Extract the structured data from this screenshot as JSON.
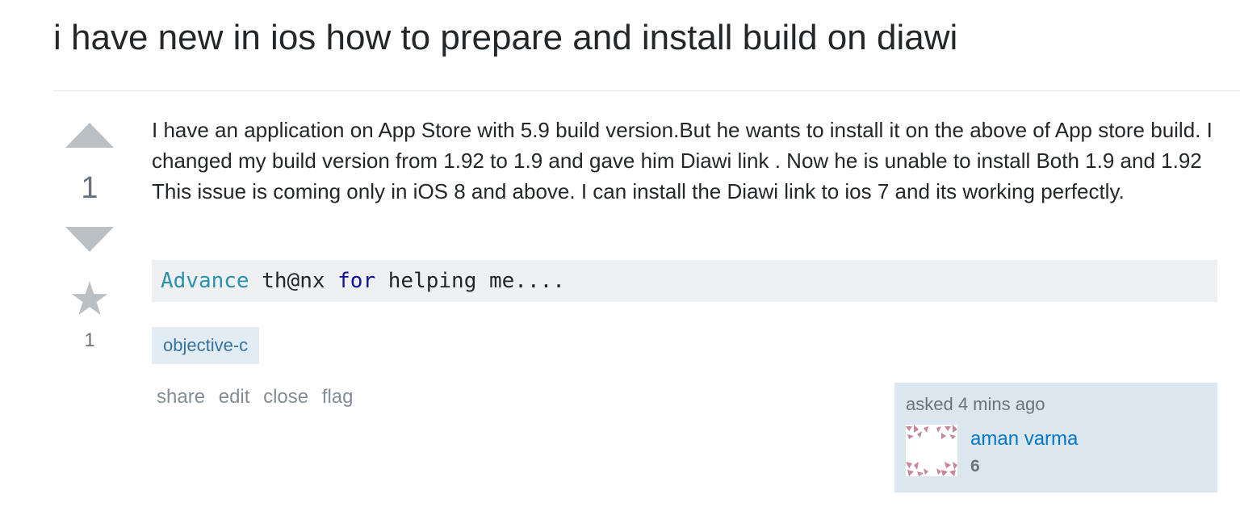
{
  "question": {
    "title": "i have new in ios how to prepare and install build on diawi",
    "body": "I have an application on App Store with 5.9 build version.But he wants to install it on the above of App store build. I changed my build version from 1.92 to 1.9 and gave him Diawi link . Now he is unable to install Both 1.9 and 1.92 This issue is coming only in iOS 8 and above. I can install the Diawi link to ios 7 and its working perfectly.",
    "code": {
      "tok1": "Advance",
      "tok2": " th@nx ",
      "tok3": "for",
      "tok4": " helping me...."
    },
    "tags": [
      "objective-c"
    ]
  },
  "votes": {
    "score": "1",
    "favorites": "1",
    "upvote_icon": "triangle-up-icon",
    "downvote_icon": "triangle-down-icon",
    "favorite_icon": "star-icon",
    "star_glyph": "★"
  },
  "post_menu": {
    "share": "share",
    "edit": "edit",
    "close": "close",
    "flag": "flag"
  },
  "owner": {
    "asked": "asked 4 mins ago",
    "name": "aman varma",
    "reputation": "6",
    "avatar_icon": "identicon-avatar"
  },
  "colors": {
    "vote_arrow": "#bbc0c4",
    "tag_bg": "#e1ecf4",
    "tag_text": "#39739d",
    "owner_bg": "#dce6ee",
    "link": "#0077cc",
    "identicon": "#c9859c"
  }
}
